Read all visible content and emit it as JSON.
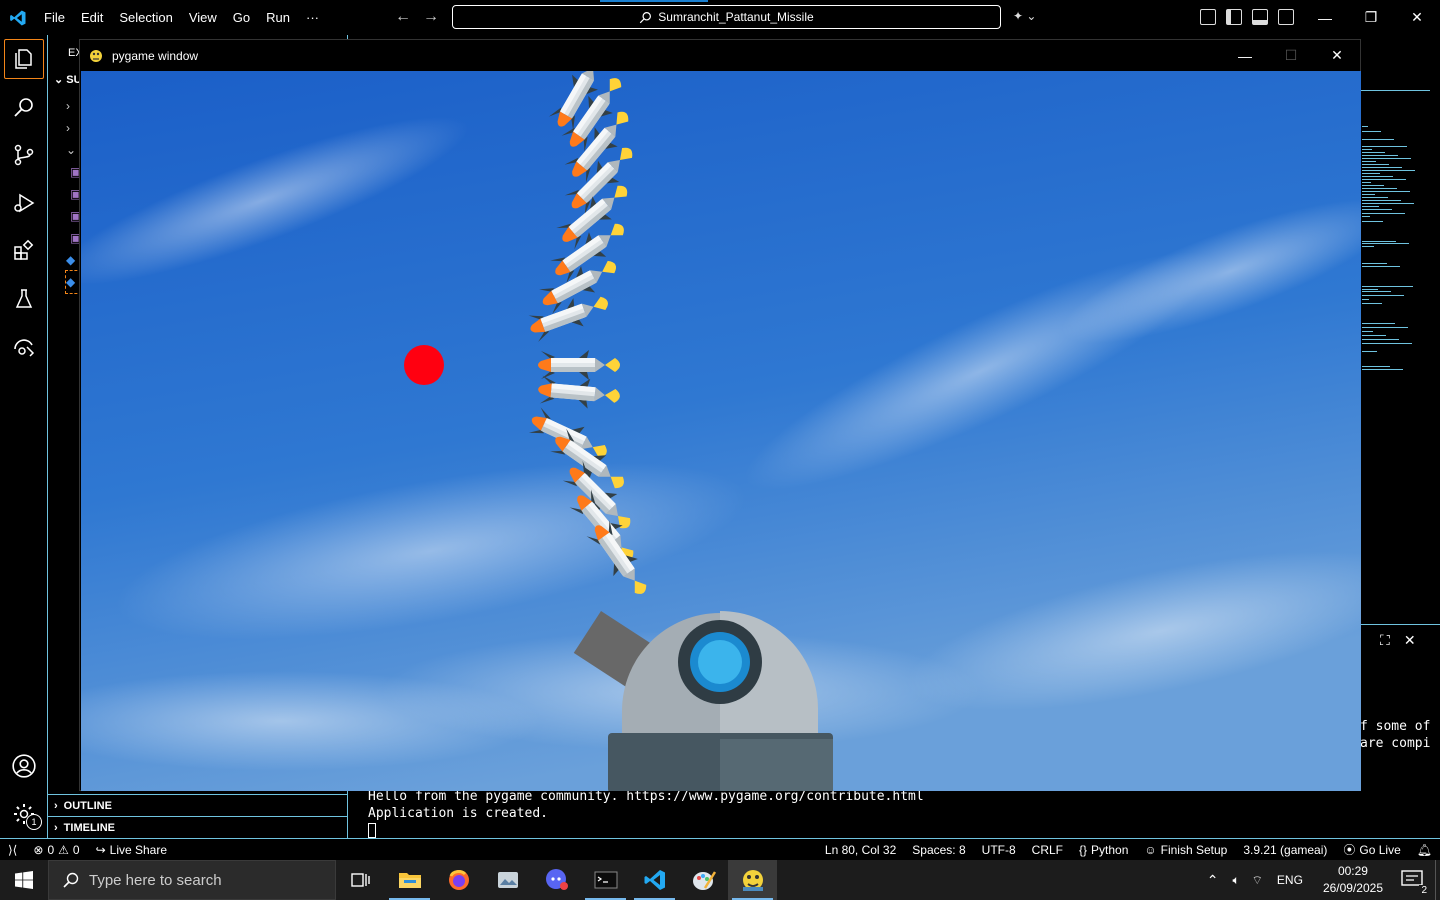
{
  "vscode": {
    "menu": [
      "File",
      "Edit",
      "Selection",
      "View",
      "Go",
      "Run",
      "···"
    ],
    "command_center": "Sumranchit_Pattanut_Missile",
    "sidebar": {
      "title": "EX",
      "folder": "SU",
      "sections": [
        "OUTLINE",
        "TIMELINE"
      ]
    },
    "terminal_lines": [
      "Hello from the pygame community. https://www.pygame.org/contribute.html",
      "Application is created."
    ],
    "terminal_right_fragments": [
      "f some of",
      "are compi"
    ],
    "account_badge": "1"
  },
  "pygame_window": {
    "title": "pygame window",
    "colors": {
      "sky_top": "#1a5fc7",
      "sky_bottom": "#5e98d6",
      "target": "#ff0010",
      "cannon_barrel": "#686868",
      "turret_dome": "#a4adb4",
      "turret_base": "#465761",
      "lens": "#3bb4ec"
    }
  },
  "status_bar": {
    "errors": "0",
    "warnings": "0",
    "live_share": "Live Share",
    "position": "Ln 80, Col 32",
    "spaces": "Spaces: 8",
    "encoding": "UTF-8",
    "eol": "CRLF",
    "language": "Python",
    "finish_setup": "Finish Setup",
    "interpreter": "3.9.21 (gameai)",
    "go_live": "Go Live"
  },
  "taskbar": {
    "search_placeholder": "Type here to search",
    "lang": "ENG",
    "time": "00:29",
    "date": "26/09/2025",
    "notifications": "2"
  }
}
